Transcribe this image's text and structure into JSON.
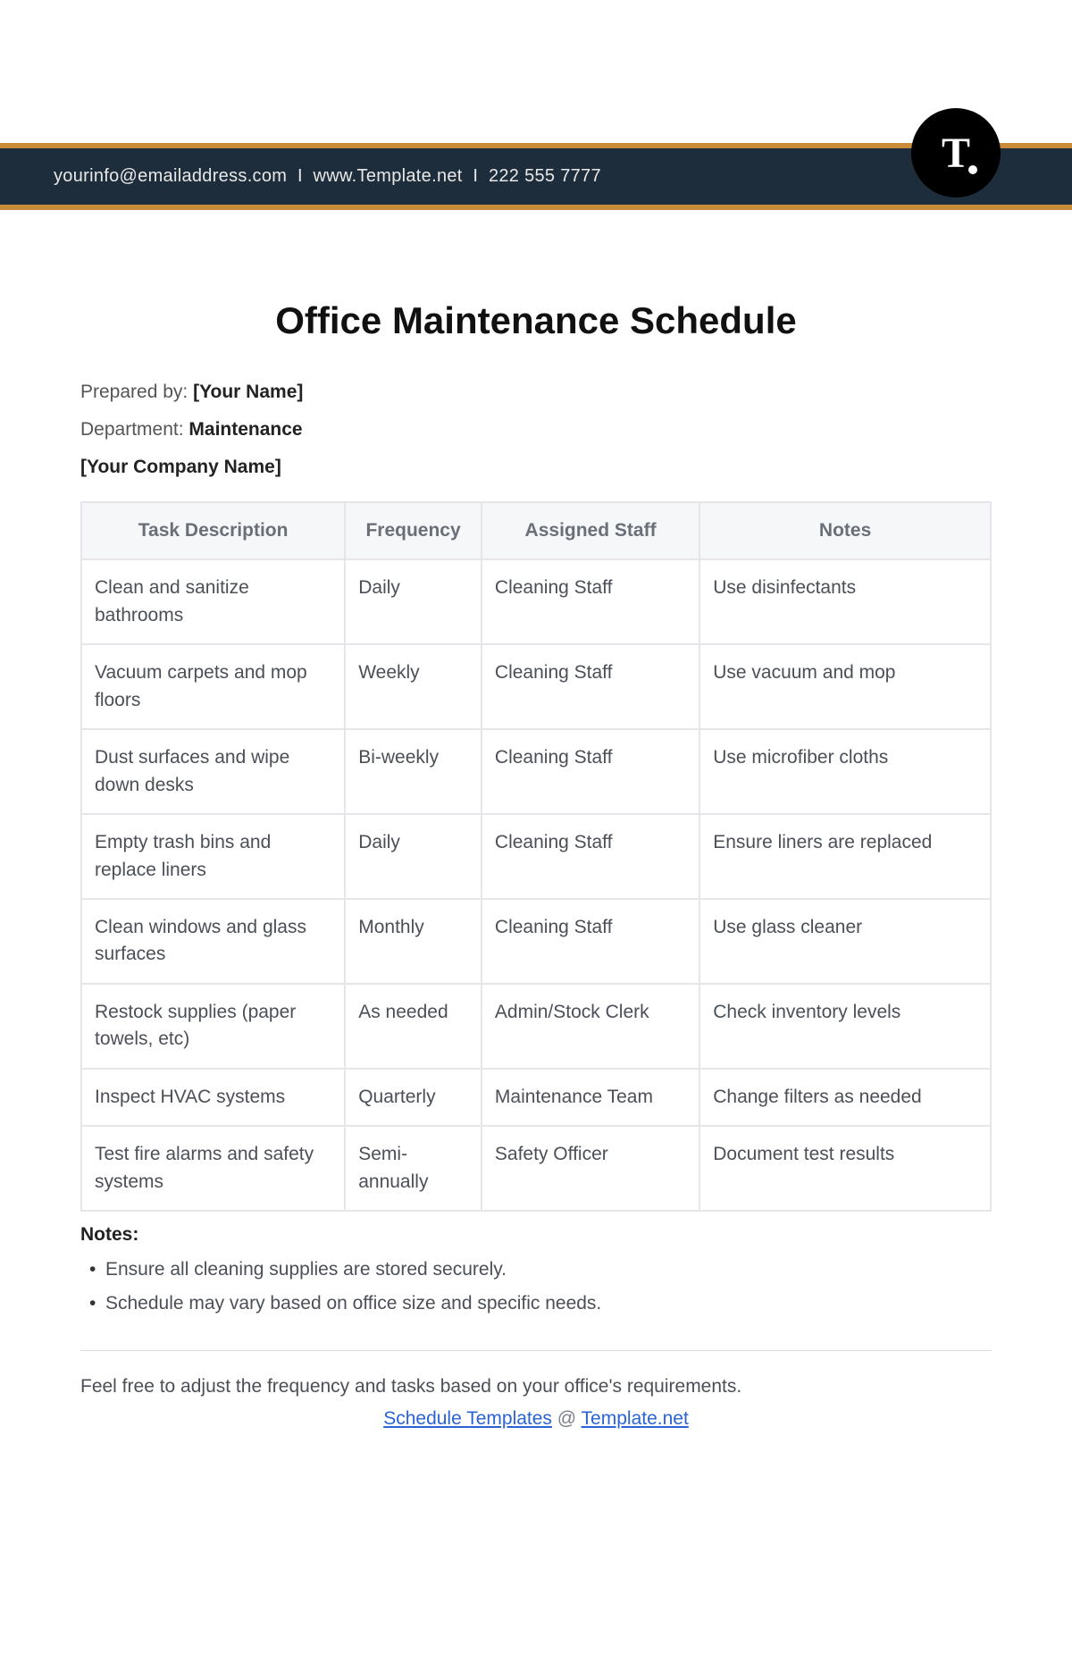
{
  "header": {
    "email": "yourinfo@emailaddress.com",
    "website": "www.Template.net",
    "phone": "222 555 7777",
    "logo_letter": "T"
  },
  "document": {
    "title": "Office Maintenance Schedule",
    "prepared_by_label": "Prepared by: ",
    "prepared_by_value": "[Your Name]",
    "department_label": "Department: ",
    "department_value": "Maintenance",
    "company_placeholder": "[Your Company Name]"
  },
  "table": {
    "headers": {
      "task": "Task Description",
      "frequency": "Frequency",
      "staff": "Assigned Staff",
      "notes": "Notes"
    },
    "rows": [
      {
        "task": "Clean and sanitize bathrooms",
        "frequency": "Daily",
        "staff": "Cleaning Staff",
        "notes": "Use disinfectants"
      },
      {
        "task": "Vacuum carpets and mop floors",
        "frequency": "Weekly",
        "staff": "Cleaning Staff",
        "notes": "Use vacuum and mop"
      },
      {
        "task": "Dust surfaces and wipe down desks",
        "frequency": "Bi-weekly",
        "staff": "Cleaning Staff",
        "notes": "Use microfiber cloths"
      },
      {
        "task": "Empty trash bins and replace liners",
        "frequency": "Daily",
        "staff": "Cleaning Staff",
        "notes": "Ensure liners are replaced"
      },
      {
        "task": "Clean windows and glass surfaces",
        "frequency": "Monthly",
        "staff": "Cleaning Staff",
        "notes": "Use glass cleaner"
      },
      {
        "task": "Restock supplies (paper towels, etc)",
        "frequency": "As needed",
        "staff": "Admin/Stock Clerk",
        "notes": "Check inventory levels"
      },
      {
        "task": "Inspect HVAC systems",
        "frequency": "Quarterly",
        "staff": "Maintenance Team",
        "notes": "Change filters as needed"
      },
      {
        "task": "Test fire alarms and safety systems",
        "frequency": "Semi-annually",
        "staff": "Safety Officer",
        "notes": "Document test results"
      }
    ]
  },
  "notes_section": {
    "heading": "Notes:",
    "items": [
      "Ensure all cleaning supplies are stored securely.",
      "Schedule may vary based on office size and specific needs."
    ]
  },
  "footer": {
    "disclaimer": "Feel free to adjust the frequency and tasks based on your office's requirements.",
    "link_text_1": "Schedule Templates",
    "link_sep": " @ ",
    "link_text_2": "Template.net"
  }
}
